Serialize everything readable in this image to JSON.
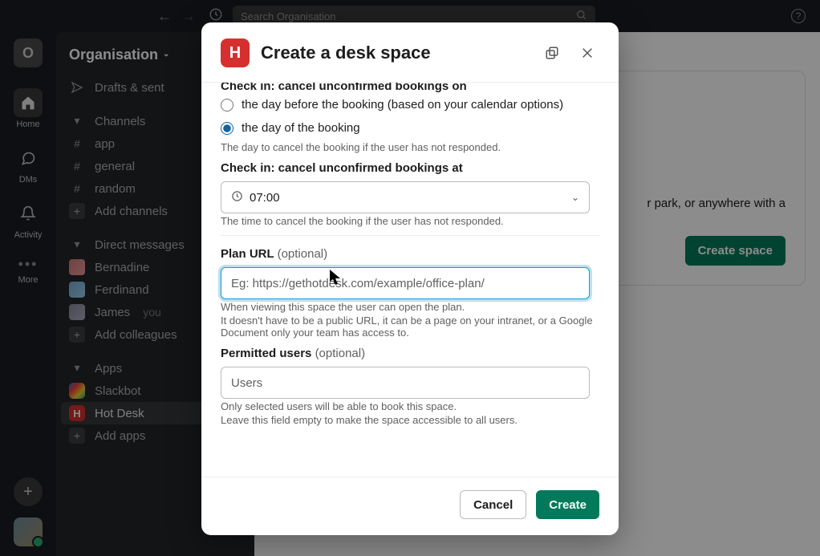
{
  "search_placeholder": "Search Organisation",
  "rail": {
    "org_letter": "O",
    "home": "Home",
    "dms": "DMs",
    "activity": "Activity",
    "more": "More"
  },
  "sidebar": {
    "org_name": "Organisation",
    "drafts": "Drafts & sent",
    "channels_label": "Channels",
    "channels": [
      "app",
      "general",
      "random"
    ],
    "add_channels": "Add channels",
    "dm_label": "Direct messages",
    "dms": [
      {
        "name": "Bernadine"
      },
      {
        "name": "Ferdinand"
      },
      {
        "name": "James",
        "you": true
      }
    ],
    "you_label": "you",
    "add_colleagues": "Add colleagues",
    "apps_label": "Apps",
    "apps": [
      {
        "name": "Slackbot"
      },
      {
        "name": "Hot Desk",
        "selected": true
      }
    ],
    "add_apps": "Add apps"
  },
  "main": {
    "bg_text_suffix": "r park, or anywhere with a",
    "create_space": "Create space"
  },
  "modal": {
    "title": "Create a desk space",
    "partial_heading": "Check in: cancel unconfirmed bookings on",
    "radio_day_before": "the day before the booking (based on your calendar options)",
    "radio_day_of": "the day of the booking",
    "checkin_on_helper": "The day to cancel the booking if the user has not responded.",
    "checkin_at_label": "Check in: cancel unconfirmed bookings at",
    "checkin_at_value": "07:00",
    "checkin_at_helper": "The time to cancel the booking if the user has not responded.",
    "plan_label": "Plan URL",
    "optional": "(optional)",
    "plan_placeholder": "Eg: https://gethotdesk.com/example/office-plan/",
    "plan_helper_1": "When viewing this space the user can open the plan.",
    "plan_helper_2": "It doesn't have to be a public URL, it can be a page on your intranet, or a Google Document only your team has access to.",
    "permitted_label": "Permitted users",
    "permitted_placeholder": "Users",
    "permitted_helper_1": "Only selected users will be able to book this space.",
    "permitted_helper_2": "Leave this field empty to make the space accessible to all users.",
    "cancel": "Cancel",
    "create": "Create"
  }
}
